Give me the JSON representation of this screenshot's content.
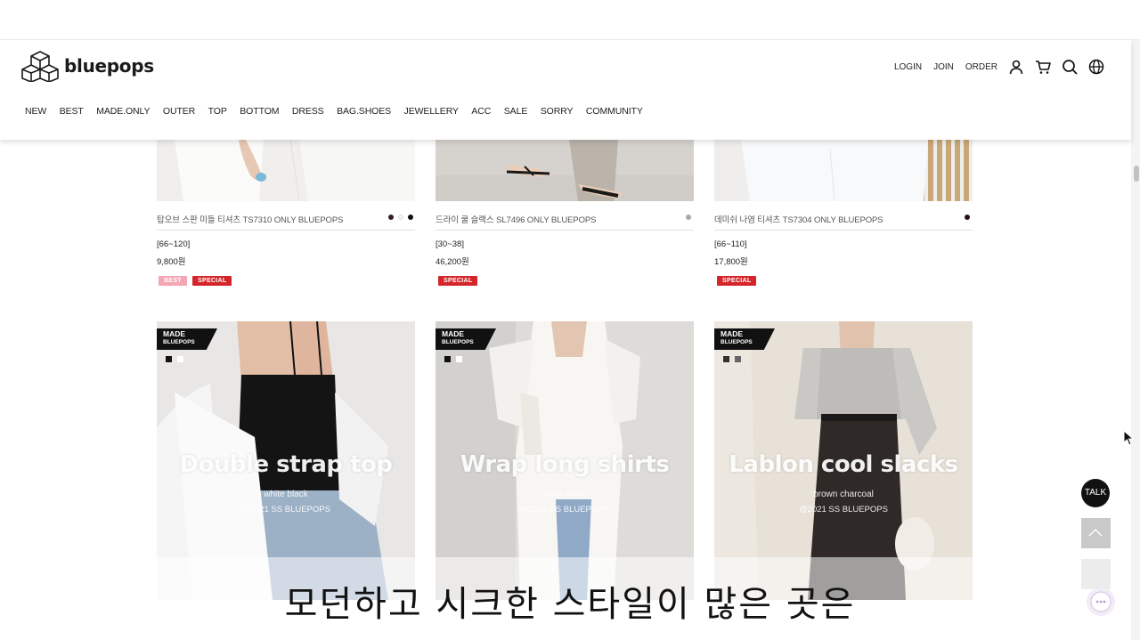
{
  "brand": {
    "name": "bluepops"
  },
  "util_links": [
    "LOGIN",
    "JOIN",
    "ORDER"
  ],
  "util_icons": [
    "user-icon",
    "cart-icon",
    "search-icon",
    "globe-icon"
  ],
  "nav": [
    "NEW",
    "BEST",
    "MADE.ONLY",
    "OUTER",
    "TOP",
    "BOTTOM",
    "DRESS",
    "BAG.SHOES",
    "JEWELLERY",
    "ACC",
    "SALE",
    "SORRY",
    "COMMUNITY"
  ],
  "products": [
    {
      "name": "탑오브 스판 미들 티셔츠 TS7310 ONLY BLUEPOPS",
      "size": "[66~120]",
      "price": "9,800원",
      "badges": [
        "BEST",
        "SPECIAL"
      ],
      "colors": [
        "#3a1c1c",
        "#f2f2f2",
        "#111111"
      ]
    },
    {
      "name": "드라이 쿨 슬랙스 SL7496 ONLY BLUEPOPS",
      "size": "[30~38]",
      "price": "46,200원",
      "badges": [
        "SPECIAL"
      ],
      "colors": [
        "#a8a8a8"
      ]
    },
    {
      "name": "데미쉬 나염 티셔츠 TS7304 ONLY BLUEPOPS",
      "size": "[66~110]",
      "price": "17,800원",
      "badges": [
        "SPECIAL"
      ],
      "colors": [
        "#2a0f0f"
      ]
    }
  ],
  "made_label": {
    "line1": "MADE",
    "line2": "BLUEPOPS"
  },
  "photos": [
    {
      "title": "Double strap top",
      "colors": "white  black",
      "copy": "@2021 SS BLUEPOPS",
      "swatches": [
        "#111111",
        "#ffffff"
      ]
    },
    {
      "title": "Wrap long shirts",
      "colors": "ivory  black",
      "copy": "@2021 SS BLUEPOPS",
      "swatches": [
        "#111111",
        "#ffffff"
      ]
    },
    {
      "title": "Lablon cool slacks",
      "colors": "brown  charcoal",
      "copy": "@2021 SS BLUEPOPS",
      "swatches": [
        "#3b2f2a",
        "#666666"
      ]
    }
  ],
  "floating": {
    "talk": "TALK"
  },
  "subtitle": "모던하고 시크한 스타일이 많은 곳은"
}
